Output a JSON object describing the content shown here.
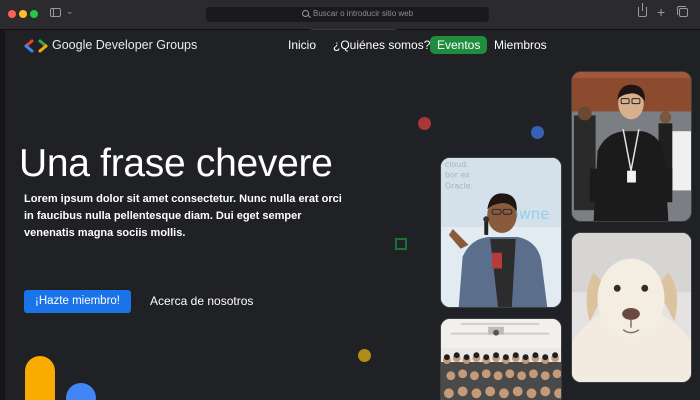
{
  "browser": {
    "url_placeholder": "Buscar o introducir sitio web",
    "icons": [
      "sidebar-icon",
      "chevron-down-icon",
      "search-icon",
      "share-icon",
      "plus-icon",
      "tabs-icon"
    ]
  },
  "header": {
    "brand": "Google Developer Groups",
    "nav": [
      {
        "label": "Inicio"
      },
      {
        "label": "¿Quiénes somos?"
      },
      {
        "label": "Eventos",
        "active": true
      },
      {
        "label": "Miembros"
      }
    ]
  },
  "hero": {
    "title": "Una frase chevere",
    "description": "Lorem ipsum dolor sit amet consectetur. Nunc nulla erat orci in faucibus nulla pellentesque diam. Dui eget semper venenatis magna sociis mollis.",
    "cta_label": "¡Hazte miembro!",
    "secondary_label": "Acerca de nosotros"
  },
  "photos": {
    "speaker_slide_text": "cloud.\nbor ex\nOracle.",
    "speaker_slide_brand": "owne"
  },
  "colors": {
    "page_bg": "#202124",
    "active_nav": "#1e8e3e",
    "cta": "#1a73e8",
    "google_blue": "#4285f4",
    "google_red": "#ea4335",
    "google_yellow": "#f9ab00",
    "google_green": "#34a853"
  }
}
